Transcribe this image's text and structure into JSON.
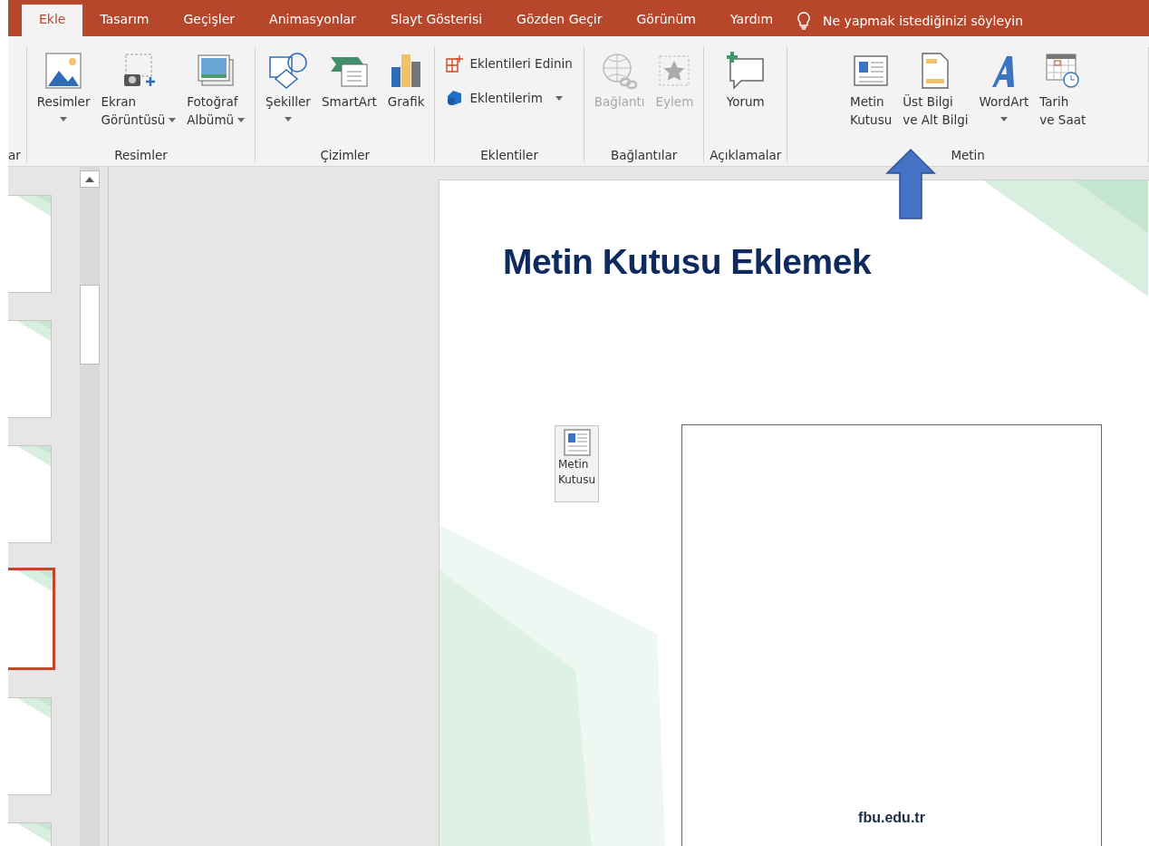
{
  "tabs": [
    {
      "label": "Ekle",
      "selected": true
    },
    {
      "label": "Tasarım",
      "selected": false
    },
    {
      "label": "Geçişler",
      "selected": false
    },
    {
      "label": "Animasyonlar",
      "selected": false
    },
    {
      "label": "Slayt Gösterisi",
      "selected": false
    },
    {
      "label": "Gözden Geçir",
      "selected": false
    },
    {
      "label": "Görünüm",
      "selected": false
    },
    {
      "label": "Yardım",
      "selected": false
    }
  ],
  "tell_me": {
    "placeholder": "Ne yapmak istediğinizi söyleyin"
  },
  "ribbon": {
    "groups": [
      {
        "label": "ar",
        "kind": "cut"
      },
      {
        "label": "Resimler",
        "kind": "large",
        "buttons": [
          {
            "lines": [
              "Resimler"
            ],
            "dropdown": true,
            "disabled": false
          },
          {
            "lines": [
              "Ekran",
              "Görüntüsü"
            ],
            "dropdown": true,
            "disabled": false
          },
          {
            "lines": [
              "Fotoğraf",
              "Albümü"
            ],
            "dropdown": true,
            "disabled": false
          }
        ]
      },
      {
        "label": "Çizimler",
        "kind": "large",
        "buttons": [
          {
            "lines": [
              "Şekiller"
            ],
            "dropdown": true,
            "disabled": false
          },
          {
            "lines": [
              "SmartArt"
            ],
            "dropdown": false,
            "disabled": false
          },
          {
            "lines": [
              "Grafik"
            ],
            "dropdown": false,
            "disabled": false
          }
        ]
      },
      {
        "label": "Eklentiler",
        "kind": "small",
        "buttons": [
          {
            "lines": [
              "Eklentileri Edinin"
            ],
            "dropdown": false,
            "disabled": false
          },
          {
            "lines": [
              "Eklentilerim"
            ],
            "dropdown": true,
            "disabled": false
          }
        ]
      },
      {
        "label": "Bağlantılar",
        "kind": "large",
        "buttons": [
          {
            "lines": [
              "Bağlantı"
            ],
            "dropdown": false,
            "disabled": true
          },
          {
            "lines": [
              "Eylem"
            ],
            "dropdown": false,
            "disabled": true
          }
        ]
      },
      {
        "label": "Açıklamalar",
        "kind": "large",
        "buttons": [
          {
            "lines": [
              "Yorum"
            ],
            "dropdown": false,
            "disabled": false
          }
        ]
      },
      {
        "label": "Metin",
        "kind": "large",
        "buttons": [
          {
            "lines": [
              "Metin",
              "Kutusu"
            ],
            "dropdown": false,
            "disabled": false
          },
          {
            "lines": [
              "Üst Bilgi",
              "ve Alt Bilgi"
            ],
            "dropdown": false,
            "disabled": false
          },
          {
            "lines": [
              "WordArt"
            ],
            "dropdown": true,
            "disabled": false
          },
          {
            "lines": [
              "Tarih",
              "ve Saat"
            ],
            "dropdown": false,
            "disabled": false
          }
        ]
      }
    ]
  },
  "thumbnails": [
    {
      "selected": false
    },
    {
      "selected": false
    },
    {
      "selected": false
    },
    {
      "selected": true
    },
    {
      "selected": false
    },
    {
      "selected": false
    }
  ],
  "slide": {
    "title": "Metin Kutusu Eklemek",
    "tool_label": [
      "Metin",
      "Kutusu"
    ],
    "footer": "fbu.edu.tr"
  }
}
